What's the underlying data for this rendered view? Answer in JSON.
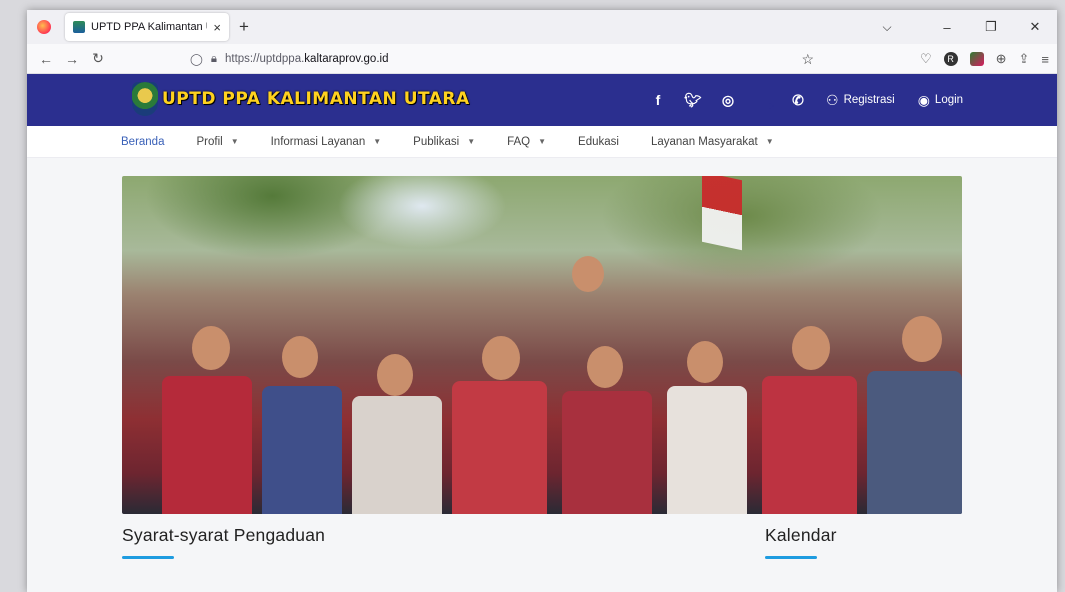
{
  "browser": {
    "tab_title": "UPTD PPA Kalimantan Utara",
    "tab_close": "×",
    "new_tab": "+",
    "url_prefix": "https://uptdppa.",
    "url_domain": "kaltaraprov.go.id",
    "window_controls": {
      "minimize": "–",
      "restore": "❐",
      "close": "✕",
      "tabs_menu": "⌵"
    },
    "nav": {
      "back": "←",
      "forward": "→",
      "reload": "↻"
    }
  },
  "site": {
    "logo_text": "UPTD PPA KALIMANTAN UTARA",
    "social_icons": [
      "facebook-icon",
      "twitter-icon",
      "instagram-icon",
      "youtube-icon",
      "whatsapp-icon"
    ],
    "register_label": "Registrasi",
    "login_label": "Login",
    "header_color": "#2b2f8f",
    "accent_color": "#1e9ce0"
  },
  "menu": {
    "items": [
      {
        "label": "Beranda",
        "dropdown": false,
        "active": true
      },
      {
        "label": "Profil",
        "dropdown": true
      },
      {
        "label": "Informasi Layanan",
        "dropdown": true
      },
      {
        "label": "Publikasi",
        "dropdown": true
      },
      {
        "label": "FAQ",
        "dropdown": true
      },
      {
        "label": "Edukasi",
        "dropdown": false
      },
      {
        "label": "Layanan Masyarakat",
        "dropdown": true
      }
    ]
  },
  "main": {
    "left_heading": "Syarat-syarat Pengaduan",
    "right_heading": "Kalendar"
  }
}
